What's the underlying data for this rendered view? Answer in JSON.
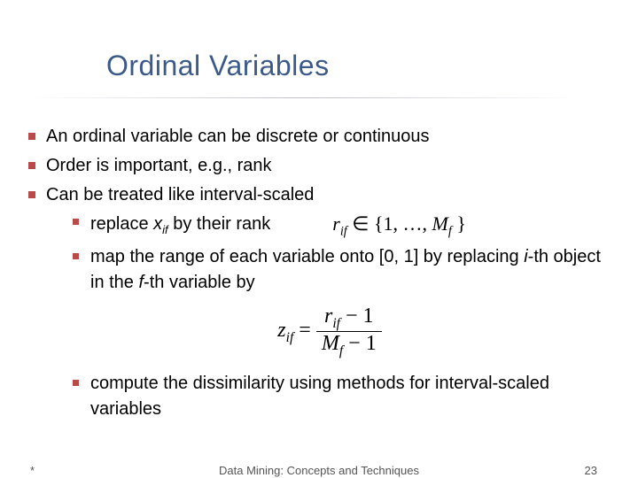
{
  "title": "Ordinal Variables",
  "bullets": {
    "b1": "An ordinal variable can be discrete or continuous",
    "b2": "Order is important, e.g., rank",
    "b3": "Can be treated like interval-scaled",
    "s1_pre": "replace ",
    "s1_var": "x",
    "s1_sub": "if",
    "s1_post": " by their rank",
    "set_r": "r",
    "set_r_sub": "if",
    "set_op": " ∈ {1, …, ",
    "set_M": "M",
    "set_M_sub": "f",
    "set_close": " }",
    "s2a": "map the range of each variable onto [0, 1] by replacing ",
    "s2_i": "i",
    "s2_mid": "-th object in the ",
    "s2_f": "f",
    "s2_end": "-th variable by",
    "z": "z",
    "z_sub": "if",
    "eq_eq": " = ",
    "num_r": "r",
    "num_r_sub": "if",
    "num_tail": " − 1",
    "den_M": "M",
    "den_M_sub": "f",
    "den_tail": " − 1",
    "s3": "compute the dissimilarity using methods for interval-scaled variables"
  },
  "footer": {
    "left": "*",
    "center": "Data Mining: Concepts and Techniques",
    "page": "23"
  }
}
